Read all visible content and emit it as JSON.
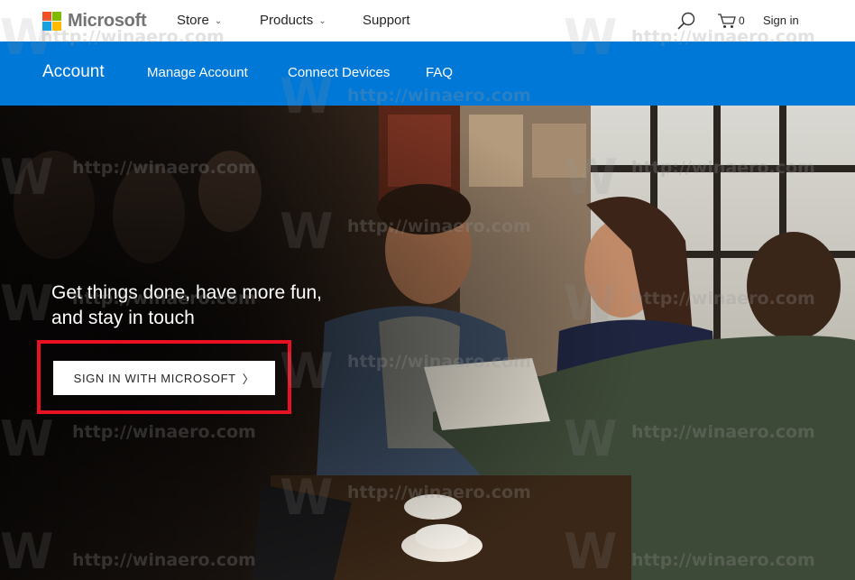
{
  "header": {
    "logo_text": "Microsoft",
    "logo_colors": [
      "#f25022",
      "#7fba00",
      "#00a4ef",
      "#ffb900"
    ],
    "nav": [
      {
        "label": "Store",
        "has_dropdown": true
      },
      {
        "label": "Products",
        "has_dropdown": true
      },
      {
        "label": "Support",
        "has_dropdown": false
      }
    ],
    "search_icon": "search-icon",
    "cart_icon": "cart-icon",
    "cart_count": "0",
    "sign_in": "Sign in"
  },
  "account_bar": {
    "title": "Account",
    "links": [
      "Manage Account",
      "Connect Devices",
      "FAQ"
    ],
    "background": "#0078d7"
  },
  "hero": {
    "headline_line1": "Get things done, have more fun,",
    "headline_line2": "and stay in touch",
    "signin_button": "SIGN IN WITH MICROSOFT",
    "highlight_color": "#e81123"
  },
  "watermark": {
    "text": "http://winaero.com",
    "letter": "W"
  }
}
